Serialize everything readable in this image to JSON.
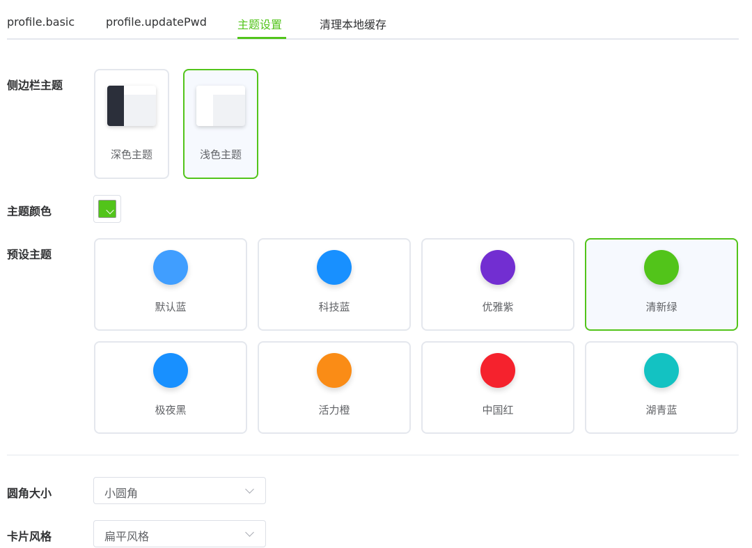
{
  "tabs": [
    {
      "label": "profile.basic"
    },
    {
      "label": "profile.updatePwd"
    },
    {
      "label": "主题设置"
    },
    {
      "label": "清理本地缓存"
    }
  ],
  "active_tab": "主题设置",
  "accent_color": "#52c41a",
  "sidebar_theme": {
    "label": "侧边栏主题",
    "options": [
      {
        "name": "深色主题",
        "sidebar_color": "#2b2f3a"
      },
      {
        "name": "浅色主题",
        "sidebar_color": "#ffffff"
      }
    ],
    "selected": "浅色主题"
  },
  "theme_color": {
    "label": "主题颜色",
    "value": "#52c41a"
  },
  "preset_theme": {
    "label": "预设主题",
    "options": [
      {
        "name": "默认蓝",
        "color": "#409eff"
      },
      {
        "name": "科技蓝",
        "color": "#1890ff"
      },
      {
        "name": "优雅紫",
        "color": "#722ed1"
      },
      {
        "name": "清新绿",
        "color": "#52c41a"
      },
      {
        "name": "极夜黑",
        "color": "#1890ff"
      },
      {
        "name": "活力橙",
        "color": "#fa8c16"
      },
      {
        "name": "中国红",
        "color": "#f5222d"
      },
      {
        "name": "湖青蓝",
        "color": "#13c2c2"
      }
    ],
    "selected": "清新绿"
  },
  "radius": {
    "label": "圆角大小",
    "value": "小圆角"
  },
  "card_style": {
    "label": "卡片风格",
    "value": "扁平风格"
  }
}
